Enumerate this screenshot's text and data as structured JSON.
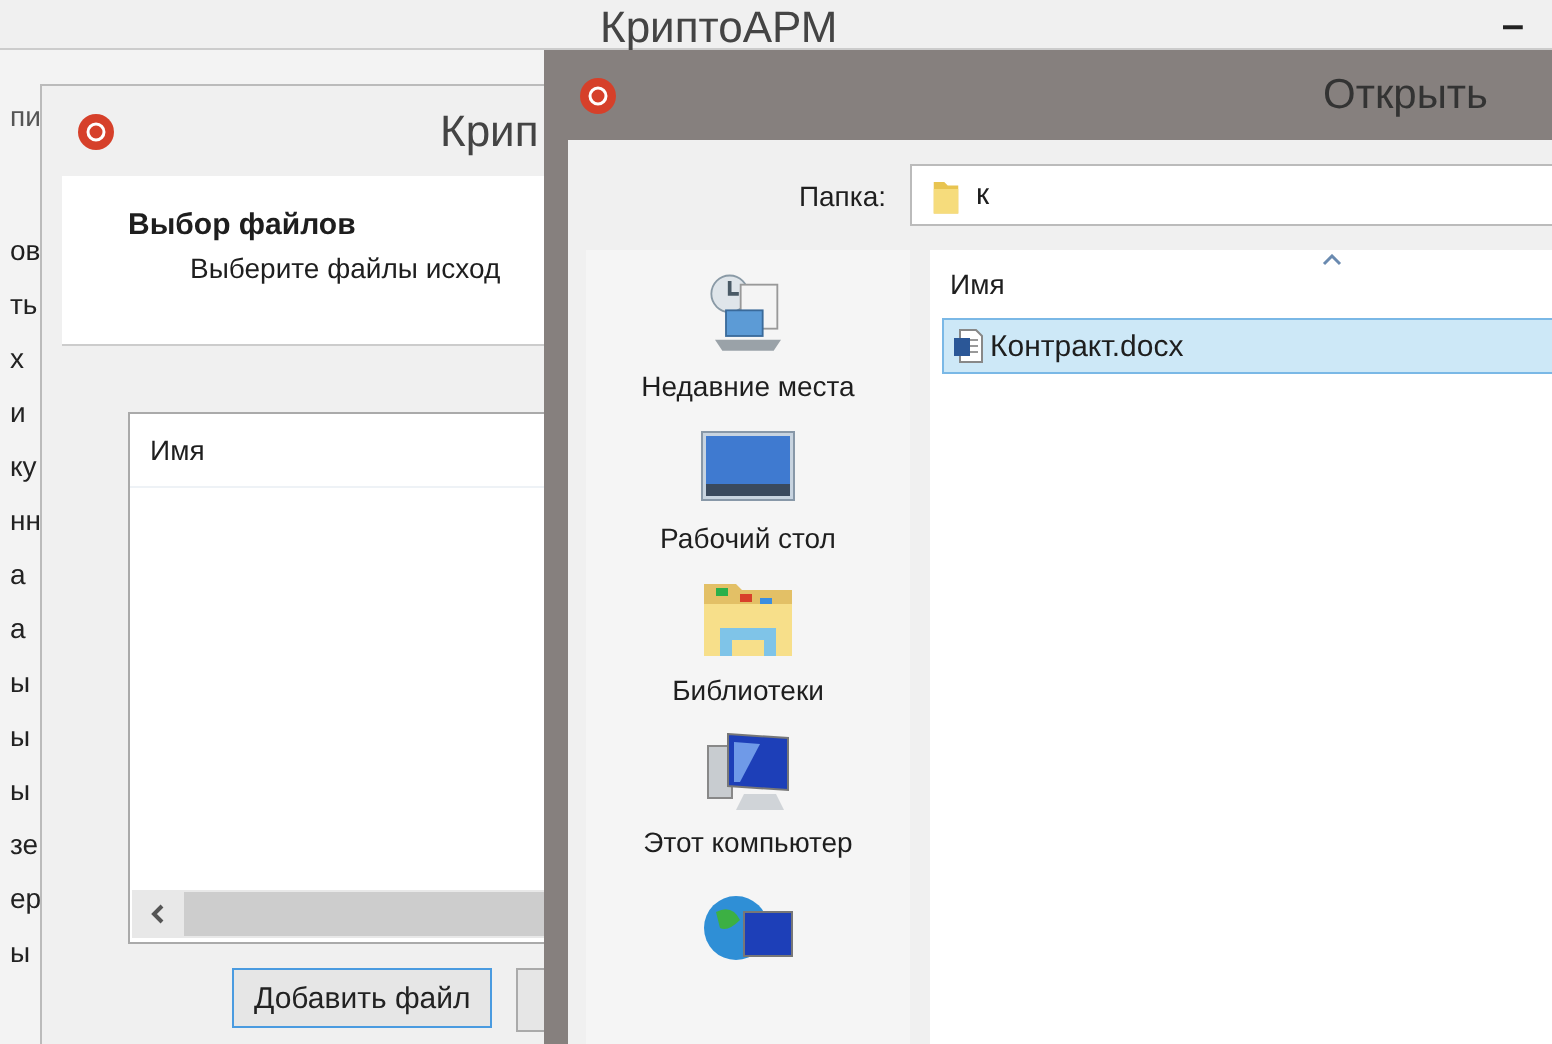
{
  "background_window": {
    "title": "КриптоАРМ",
    "minimize": "–",
    "side_fragments": [
      {
        "text": "пи",
        "kind": "tab"
      },
      {
        "text": "ов",
        "kind": "header"
      },
      {
        "text": "ть",
        "kind": "item"
      },
      {
        "text": "х",
        "kind": "item"
      },
      {
        "text": "и",
        "kind": "item"
      },
      {
        "text": "ку",
        "kind": "item"
      },
      {
        "text": "нн",
        "kind": "item"
      },
      {
        "text": "а",
        "kind": "item"
      },
      {
        "text": "а",
        "kind": "item"
      },
      {
        "text": "ы",
        "kind": "item"
      },
      {
        "text": "ы",
        "kind": "item"
      },
      {
        "text": "ы",
        "kind": "item"
      },
      {
        "text": "зе",
        "kind": "item"
      },
      {
        "text": "ер",
        "kind": "item"
      },
      {
        "text": "ы",
        "kind": "item"
      }
    ]
  },
  "wizard_window": {
    "title": "Крип",
    "heading": "Выбор файлов",
    "subheading": "Выберите файлы исход",
    "list": {
      "columns": [
        "Имя"
      ]
    },
    "buttons": [
      "Добавить файл"
    ]
  },
  "open_dialog": {
    "title": "Открыть",
    "folder_label": "Папка:",
    "folder_value": "к",
    "places": [
      {
        "kind": "recent",
        "label": "Недавние места"
      },
      {
        "kind": "desktop",
        "label": "Рабочий стол"
      },
      {
        "kind": "libraries",
        "label": "Библиотеки"
      },
      {
        "kind": "computer",
        "label": "Этот компьютер"
      },
      {
        "kind": "network"
      }
    ],
    "files": {
      "columns": [
        "Имя"
      ],
      "items": [
        {
          "name": "Контракт.docx",
          "selected": true
        }
      ]
    }
  }
}
